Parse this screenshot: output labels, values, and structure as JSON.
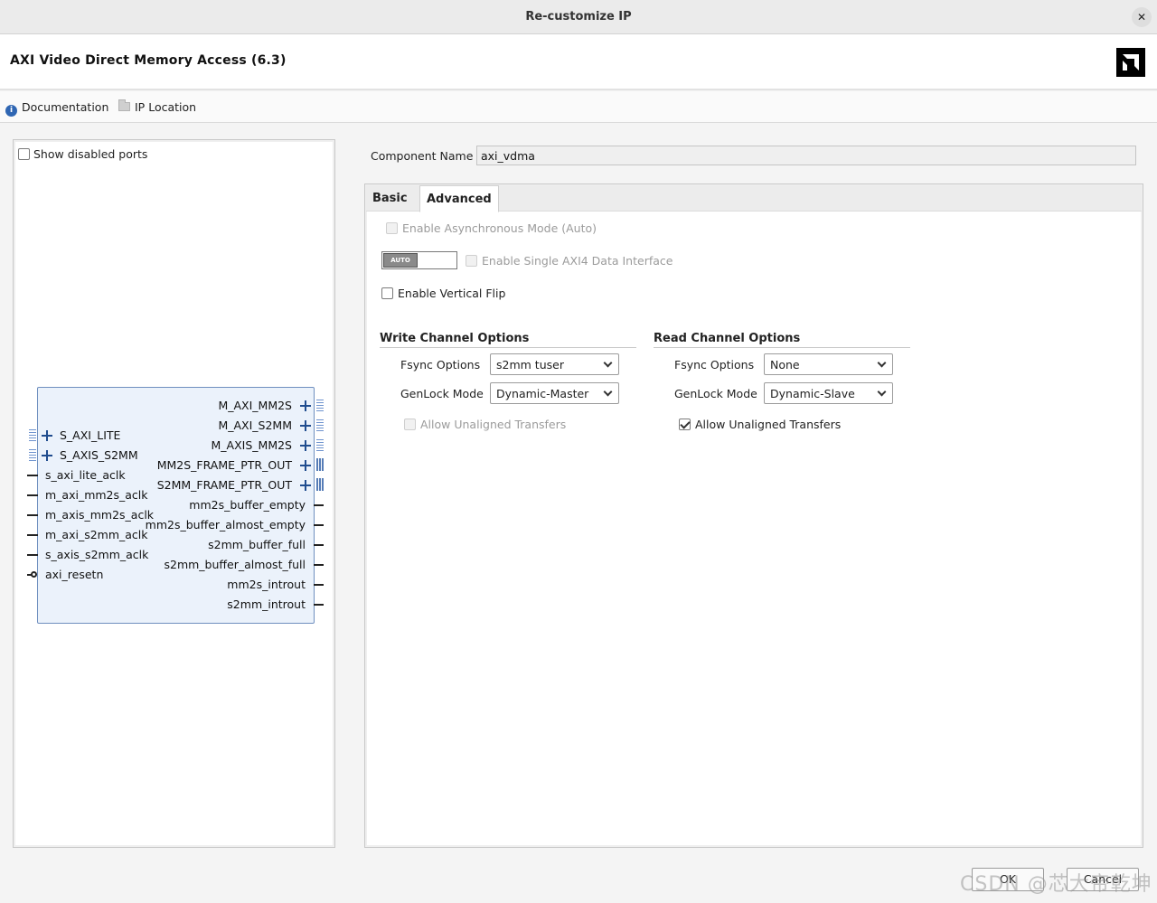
{
  "window": {
    "title": "Re-customize IP",
    "close_symbol": "✕"
  },
  "header": {
    "ip_title": "AXI Video Direct Memory Access (6.3)",
    "logo_glyph": "⊿"
  },
  "links": {
    "documentation": "Documentation",
    "ip_location": "IP Location"
  },
  "left_panel": {
    "show_disabled_ports": {
      "label": "Show disabled ports",
      "checked": false
    },
    "inputs": [
      {
        "name": "S_AXI_LITE",
        "kind": "bus"
      },
      {
        "name": "S_AXIS_S2MM",
        "kind": "bus"
      },
      {
        "name": "s_axi_lite_aclk",
        "kind": "wire"
      },
      {
        "name": "m_axi_mm2s_aclk",
        "kind": "wire"
      },
      {
        "name": "m_axis_mm2s_aclk",
        "kind": "wire"
      },
      {
        "name": "m_axi_s2mm_aclk",
        "kind": "wire"
      },
      {
        "name": "s_axis_s2mm_aclk",
        "kind": "wire"
      },
      {
        "name": "axi_resetn",
        "kind": "inverted"
      }
    ],
    "outputs": [
      {
        "name": "M_AXI_MM2S",
        "kind": "bus"
      },
      {
        "name": "M_AXI_S2MM",
        "kind": "bus"
      },
      {
        "name": "M_AXIS_MM2S",
        "kind": "bus"
      },
      {
        "name": "MM2S_FRAME_PTR_OUT",
        "kind": "vector"
      },
      {
        "name": "S2MM_FRAME_PTR_OUT",
        "kind": "vector"
      },
      {
        "name": "mm2s_buffer_empty",
        "kind": "wire"
      },
      {
        "name": "mm2s_buffer_almost_empty",
        "kind": "wire"
      },
      {
        "name": "s2mm_buffer_full",
        "kind": "wire"
      },
      {
        "name": "s2mm_buffer_almost_full",
        "kind": "wire"
      },
      {
        "name": "mm2s_introut",
        "kind": "wire"
      },
      {
        "name": "s2mm_introut",
        "kind": "wire"
      }
    ]
  },
  "component": {
    "label": "Component Name",
    "value": "axi_vdma"
  },
  "tabs": [
    {
      "label": "Basic",
      "active": false
    },
    {
      "label": "Advanced",
      "active": true
    }
  ],
  "advanced": {
    "async_mode": {
      "label": "Enable Asynchronous Mode (Auto)",
      "checked": false,
      "enabled": false
    },
    "auto_toggle_label": "AUTO",
    "single_axi4": {
      "label": "Enable Single AXI4 Data Interface",
      "checked": false,
      "enabled": false
    },
    "vertical_flip": {
      "label": "Enable Vertical Flip",
      "checked": false,
      "enabled": true
    },
    "write_channel": {
      "title": "Write Channel Options",
      "fsync_label": "Fsync Options",
      "fsync_value": "s2mm tuser",
      "genlock_label": "GenLock Mode",
      "genlock_value": "Dynamic-Master",
      "unaligned": {
        "label": "Allow Unaligned Transfers",
        "checked": false,
        "enabled": false
      }
    },
    "read_channel": {
      "title": "Read Channel Options",
      "fsync_label": "Fsync Options",
      "fsync_value": "None",
      "genlock_label": "GenLock Mode",
      "genlock_value": "Dynamic-Slave",
      "unaligned": {
        "label": "Allow Unaligned Transfers",
        "checked": true,
        "enabled": true
      }
    }
  },
  "buttons": {
    "ok": "OK",
    "cancel": "Cancel"
  },
  "watermark": "CSDN @芯大帝乾坤",
  "colors": {
    "accent": "#2f66b3",
    "ip_block_fill": "#ebf2fb",
    "ip_block_border": "#6f8fbf"
  }
}
